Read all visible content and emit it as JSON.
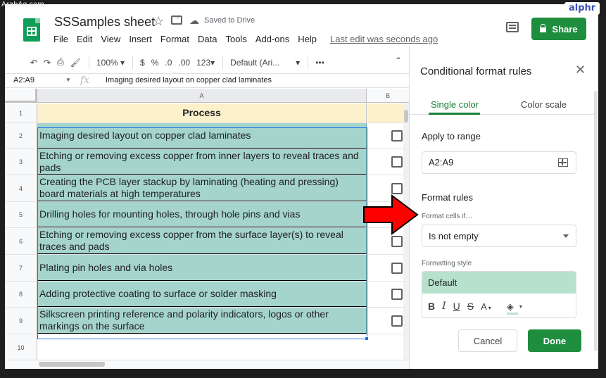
{
  "watermark": "ArabAq.com",
  "badge": "alphr",
  "header": {
    "title": "SSSamples sheet",
    "saved_status": "Saved to Drive",
    "last_edit": "Last edit was seconds ago",
    "share_label": "Share",
    "menu": [
      "File",
      "Edit",
      "View",
      "Insert",
      "Format",
      "Data",
      "Tools",
      "Add-ons",
      "Help"
    ]
  },
  "toolbar": {
    "zoom": "100%",
    "currency": "$",
    "percent": "%",
    "dec_decrease": ".0",
    "dec_increase": ".00",
    "number_format": "123",
    "font": "Default (Ari...",
    "more": "•••"
  },
  "formula_bar": {
    "name_box": "A2:A9",
    "content": "Imaging desired layout on copper clad laminates"
  },
  "grid": {
    "columns": [
      "A",
      "B"
    ],
    "header_row": {
      "num": "1",
      "value": "Process"
    },
    "rows": [
      {
        "num": "2",
        "value": "Imaging desired layout on copper clad laminates"
      },
      {
        "num": "3",
        "value": "Etching or removing excess copper from inner layers to reveal traces and pads"
      },
      {
        "num": "4",
        "value": "Creating the PCB layer stackup by laminating (heating and pressing) board materials at high temperatures"
      },
      {
        "num": "5",
        "value": "Drilling holes for mounting holes, through hole pins and vias"
      },
      {
        "num": "6",
        "value": "Etching or removing excess copper from the surface layer(s) to reveal traces and pads"
      },
      {
        "num": "7",
        "value": "Plating pin holes and via holes"
      },
      {
        "num": "8",
        "value": "Adding protective coating to surface or solder masking"
      },
      {
        "num": "9",
        "value": "Silkscreen printing reference and polarity indicators, logos or other markings on the surface"
      }
    ],
    "empty_row": {
      "num": "10"
    }
  },
  "panel": {
    "title": "Conditional format rules",
    "tabs": {
      "single": "Single color",
      "scale": "Color scale"
    },
    "apply_heading": "Apply to range",
    "range": "A2:A9",
    "rules_heading": "Format rules",
    "condition_label": "Format cells if…",
    "condition_value": "Is not empty",
    "style_label": "Formatting style",
    "style_preview": "Default",
    "style_tools": {
      "bold": "B",
      "italic": "I",
      "underline": "U",
      "strike": "S",
      "text_color": "A"
    },
    "cancel_label": "Cancel",
    "done_label": "Done"
  },
  "colors": {
    "accent_green": "#1e8e3e",
    "selection_fill": "#a5d4cd",
    "header_fill": "#fdf1cc",
    "style_preview_fill": "#b7e1cd",
    "arrow_red": "#ff0000"
  }
}
